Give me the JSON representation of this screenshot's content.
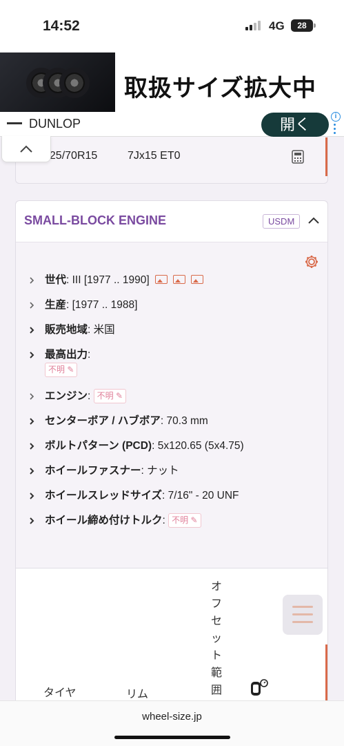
{
  "status_bar": {
    "time": "14:52",
    "network": "4G",
    "battery": "28"
  },
  "ad": {
    "headline": "取扱サイズ拡大中",
    "brand": "DUNLOP",
    "open_button": "開く",
    "info_icon": "i"
  },
  "fitment_row": {
    "tire": "225/70R15",
    "rim": "7Jx15 ET0"
  },
  "engine_card": {
    "title": "SMALL-BLOCK ENGINE",
    "market_badge": "USDM",
    "specs": [
      {
        "label": "世代",
        "value": ": III [1977 .. 1990]"
      },
      {
        "label": "生産",
        "value": ": [1977 .. 1988]"
      },
      {
        "label": "販売地域",
        "value": ": 米国"
      },
      {
        "label": "最高出力",
        "value": ":"
      },
      {
        "label": "エンジン",
        "value": ":"
      },
      {
        "label": "センターボア / ハブボア",
        "value": ": 70.3 mm"
      },
      {
        "label": "ボルトパターン (PCD)",
        "value": ": 5x120.65 (5x4.75)"
      },
      {
        "label": "ホイールファスナー",
        "value": ": ナット"
      },
      {
        "label": "ホイールスレッドサイズ",
        "value": ": 7/16\" - 20 UNF"
      },
      {
        "label": "ホイール締め付けトルク",
        "value": ":"
      }
    ],
    "unknown_label": "不明"
  },
  "table": {
    "col_tire": "タイヤ",
    "col_rim": "リム",
    "col_offset": "オフセット範囲"
  },
  "browser": {
    "url": "wheel-size.jp"
  },
  "colors": {
    "accent_purple": "#7a4aa0",
    "accent_orange": "#d96a4a",
    "unknown_pink": "#e0809a",
    "ad_button": "#163a3a"
  }
}
